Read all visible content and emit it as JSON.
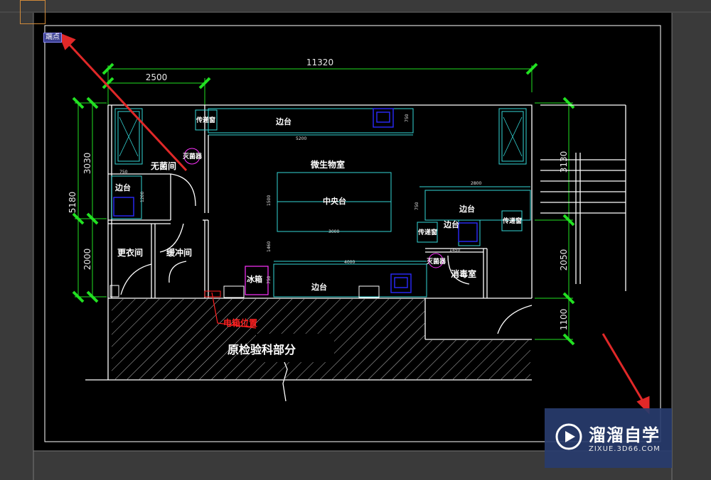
{
  "snap_tooltip": "端点",
  "drawing": {
    "dims": {
      "total_width": "11320",
      "left_width": "2500",
      "left_top": "3030",
      "left_total": "5180",
      "left_bottom": "2000",
      "right_top": "3130",
      "right_mid": "2050",
      "right_bottom": "1100",
      "counter_top_len": "5200",
      "counter_top_depth": "750",
      "counter_mid_len": "4000",
      "counter_mid_depth": "750",
      "center_len": "3000",
      "center_depth": "1500",
      "right_counter_len": "2800",
      "right_counter_depth": "750",
      "left_counter_w": "750",
      "left_counter_h": "1200",
      "gap_1460": "1460",
      "mini_1450": "1450"
    },
    "labels": {
      "biosafety_cabinet": "传递窗",
      "counter_top": "边台",
      "uv_lamp": "灭菌器",
      "sterile_room": "无菌间",
      "micro_lab": "微生物室",
      "central_bench": "中央台",
      "left_counter": "边台",
      "changing_room": "更衣间",
      "buffer_room": "缓冲间",
      "fridge": "冰箱",
      "counter_mid": "边台",
      "pass_window": "传递窗",
      "uv_lamp_2": "灭菌器",
      "disinfect_room": "消毒室",
      "right_counter": "边台",
      "pass_box": "传递窗",
      "right_counter_2": "边台",
      "power_box": "电箱位置",
      "old_dept": "原检验科部分"
    }
  },
  "watermark": {
    "title": "溜溜自学",
    "url": "ZIXUE.3D66.COM"
  },
  "colors": {
    "canvas_bg": "#000000",
    "ui_bg": "#3a3a3a",
    "wall": "#ffffff",
    "dim": "#22e022",
    "furniture": "#33d6d6",
    "sink": "#2a2aff",
    "fridge": "#ff33ff",
    "annotation_red": "#ff2020"
  }
}
